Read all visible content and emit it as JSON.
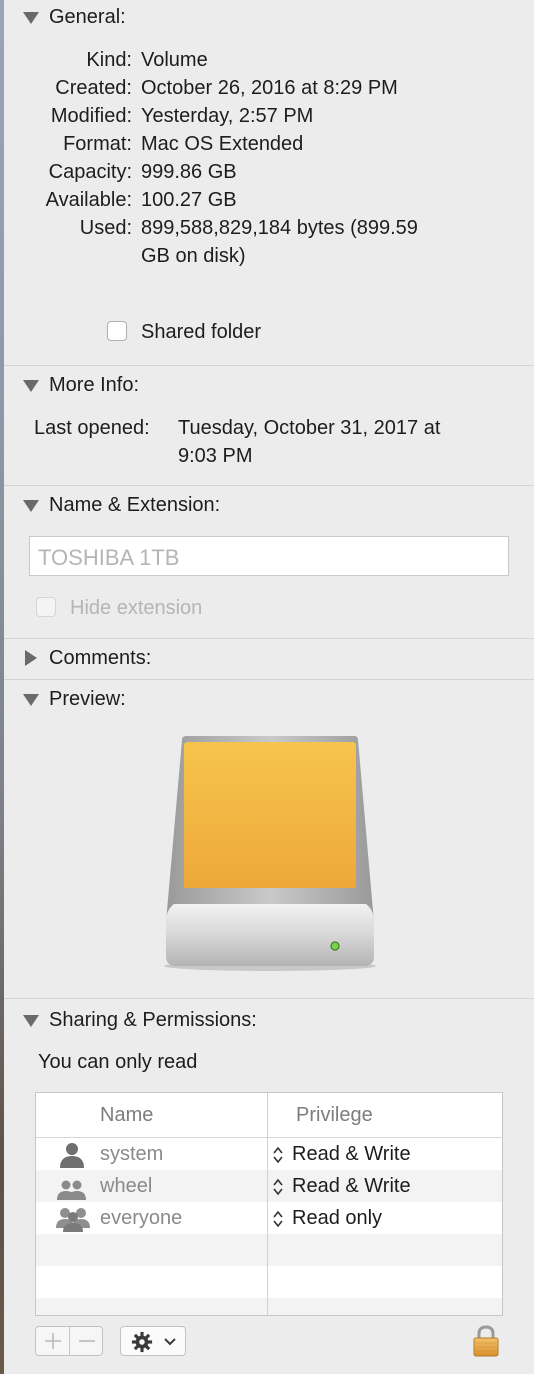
{
  "general": {
    "title": "General:",
    "rows": [
      {
        "label": "Kind:",
        "value": "Volume"
      },
      {
        "label": "Created:",
        "value": "October 26, 2016 at 8:29 PM"
      },
      {
        "label": "Modified:",
        "value": "Yesterday, 2:57 PM"
      },
      {
        "label": "Format:",
        "value": "Mac OS Extended"
      },
      {
        "label": "Capacity:",
        "value": "999.86 GB"
      },
      {
        "label": "Available:",
        "value": "100.27 GB"
      },
      {
        "label": "Used:",
        "value": "899,588,829,184 bytes (899.59",
        "value2": "GB on disk)"
      }
    ],
    "shared_folder_label": "Shared folder"
  },
  "more_info": {
    "title": "More Info:",
    "last_opened_label": "Last opened:",
    "last_opened_value": "Tuesday, October 31, 2017 at",
    "last_opened_value2": "9:03 PM"
  },
  "name_extension": {
    "title": "Name & Extension:",
    "name_value": "TOSHIBA 1TB",
    "hide_extension_label": "Hide extension"
  },
  "comments": {
    "title": "Comments:"
  },
  "preview": {
    "title": "Preview:",
    "drive_color": "#f3b63a"
  },
  "sharing": {
    "title": "Sharing & Permissions:",
    "notice": "You can only read",
    "columns": [
      "Name",
      "Privilege"
    ],
    "rows": [
      {
        "name": "system",
        "icon": "user-icon",
        "privilege": "Read & Write"
      },
      {
        "name": "wheel",
        "icon": "group-icon",
        "privilege": "Read & Write"
      },
      {
        "name": "everyone",
        "icon": "everyone-icon",
        "privilege": "Read only"
      }
    ]
  },
  "bottom_bar": {
    "add_icon": "plus-icon",
    "remove_icon": "minus-icon",
    "action_icon": "gear-icon",
    "lock_icon": "lock-icon"
  }
}
